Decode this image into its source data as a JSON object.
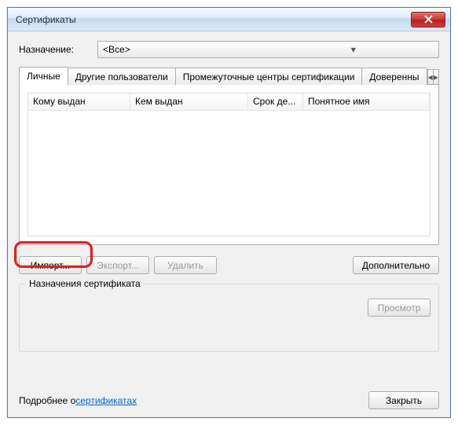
{
  "window": {
    "title": "Сертификаты"
  },
  "purpose": {
    "label": "Назначение:",
    "selected": "<Все>"
  },
  "tabs": [
    {
      "label": "Личные",
      "active": true
    },
    {
      "label": "Другие пользователи",
      "active": false
    },
    {
      "label": "Промежуточные центры сертификации",
      "active": false
    },
    {
      "label": "Доверенны",
      "active": false
    }
  ],
  "columns": {
    "issued_to": "Кому выдан",
    "issued_by": "Кем выдан",
    "expires": "Срок де...",
    "friendly": "Понятное имя"
  },
  "buttons": {
    "import": "Импорт...",
    "export": "Экспорт...",
    "remove": "Удалить",
    "advanced": "Дополнительно",
    "view": "Просмотр",
    "close": "Закрыть"
  },
  "group_title": "Назначения сертификата",
  "learn_more": {
    "prefix": "Подробнее о ",
    "link": "сертификатах"
  }
}
